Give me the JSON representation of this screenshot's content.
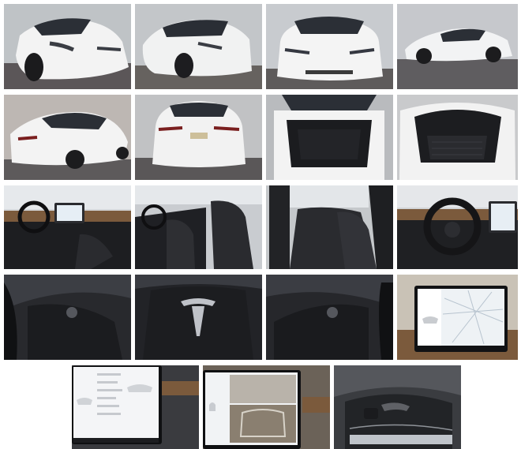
{
  "gallery": {
    "tiles": [
      {
        "id": "ext-front-left",
        "kind": "exterior"
      },
      {
        "id": "ext-front-left-2",
        "kind": "exterior"
      },
      {
        "id": "ext-front",
        "kind": "exterior"
      },
      {
        "id": "ext-side-right",
        "kind": "exterior"
      },
      {
        "id": "ext-rear-left",
        "kind": "exterior"
      },
      {
        "id": "ext-rear",
        "kind": "exterior"
      },
      {
        "id": "rear-trunk-open",
        "kind": "cargo"
      },
      {
        "id": "front-trunk-open",
        "kind": "cargo"
      },
      {
        "id": "cabin-dashboard",
        "kind": "interior"
      },
      {
        "id": "front-seats",
        "kind": "interior"
      },
      {
        "id": "rear-seats",
        "kind": "interior"
      },
      {
        "id": "driver-dashboard",
        "kind": "interior"
      },
      {
        "id": "steering-left-scroll",
        "kind": "detail"
      },
      {
        "id": "steering-logo",
        "kind": "detail"
      },
      {
        "id": "steering-right-scroll",
        "kind": "detail"
      },
      {
        "id": "touchscreen-map",
        "kind": "detail"
      },
      {
        "id": "touchscreen-settings",
        "kind": "detail"
      },
      {
        "id": "touchscreen-camera",
        "kind": "detail"
      },
      {
        "id": "glass-roof",
        "kind": "detail"
      }
    ],
    "colors": {
      "paint": "#f2f3f4",
      "glass": "#2b2f36",
      "interior": "#1d1e21",
      "wood": "#7b5a3c",
      "floor": "#5e5e62",
      "background": "#ffffff"
    }
  }
}
